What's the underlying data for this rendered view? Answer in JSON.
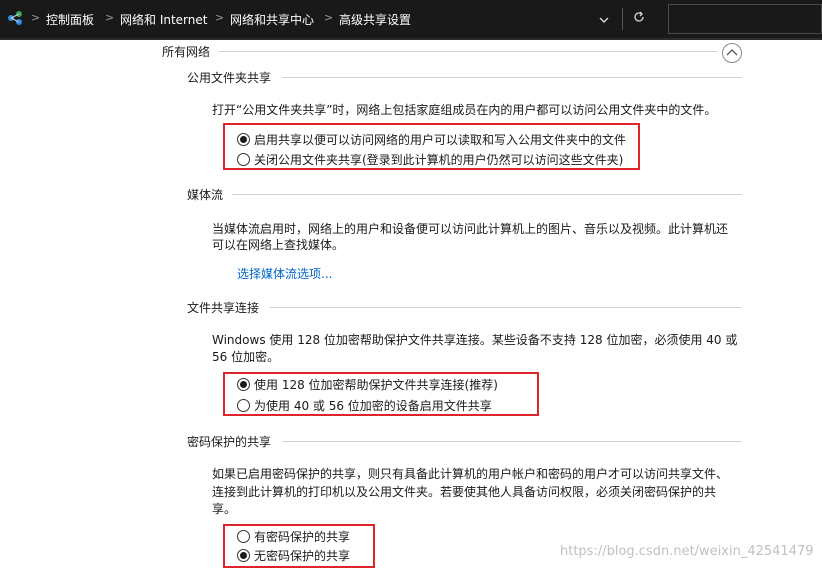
{
  "address_bar": {
    "breadcrumbs": [
      "控制面板",
      "网络和 Internet",
      "网络和共享中心",
      "高级共享设置"
    ],
    "dropdown_icon": "chevron-down-icon",
    "refresh_icon": "refresh-icon"
  },
  "group": {
    "title": "所有网络"
  },
  "sections": {
    "public_folder": {
      "title": "公用文件夹共享",
      "description": "打开“公用文件夹共享”时，网络上包括家庭组成员在内的用户都可以访问公用文件夹中的文件。",
      "options": [
        {
          "label": "启用共享以便可以访问网络的用户可以读取和写入公用文件夹中的文件",
          "checked": true
        },
        {
          "label": "关闭公用文件夹共享(登录到此计算机的用户仍然可以访问这些文件夹)",
          "checked": false
        }
      ]
    },
    "media_streaming": {
      "title": "媒体流",
      "description_line1": "当媒体流启用时，网络上的用户和设备便可以访问此计算机上的图片、音乐以及视频。此计算机还",
      "description_line2": "可以在网络上查找媒体。",
      "link": "选择媒体流选项..."
    },
    "file_sharing": {
      "title": "文件共享连接",
      "description_line1": "Windows 使用 128 位加密帮助保护文件共享连接。某些设备不支持 128 位加密，必须使用 40 或",
      "description_line2": "56 位加密。",
      "options": [
        {
          "label": "使用 128 位加密帮助保护文件共享连接(推荐)",
          "checked": true
        },
        {
          "label": "为使用 40 或 56 位加密的设备启用文件共享",
          "checked": false
        }
      ]
    },
    "password_protected": {
      "title": "密码保护的共享",
      "description_line1": "如果已启用密码保护的共享，则只有具备此计算机的用户帐户和密码的用户才可以访问共享文件、",
      "description_line2": "连接到此计算机的打印机以及公用文件夹。若要使其他人具备访问权限，必须关闭密码保护的共",
      "description_line3": "享。",
      "options": [
        {
          "label": "有密码保护的共享",
          "checked": false
        },
        {
          "label": "无密码保护的共享",
          "checked": true
        }
      ]
    }
  },
  "watermark": "https://blog.csdn.net/weixin_42541479",
  "colors": {
    "highlight_box": "#e0242b",
    "link": "#0066cc",
    "addressbar_bg": "#191919"
  }
}
